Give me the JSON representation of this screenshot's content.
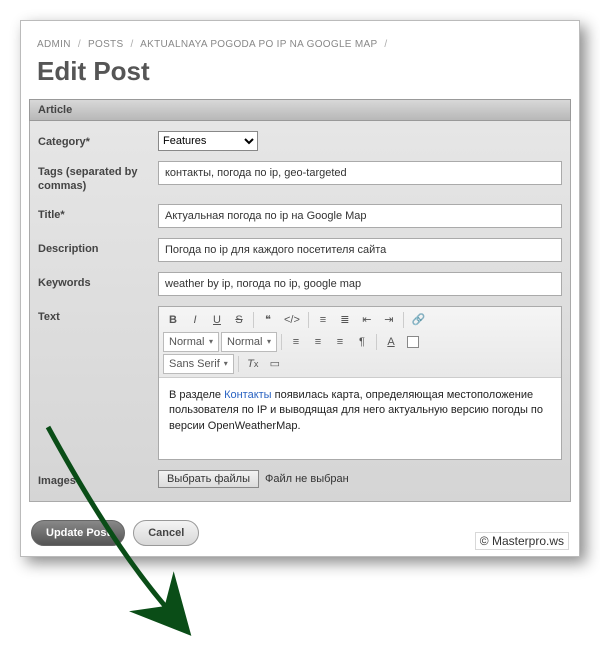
{
  "breadcrumb": [
    "ADMIN",
    "POSTS",
    "AKTUALNAYA POGODA PO IP NA GOOGLE MAP"
  ],
  "page_title": "Edit Post",
  "section_title": "Article",
  "labels": {
    "category": "Category*",
    "tags": "Tags (separated by commas)",
    "title": "Title*",
    "description": "Description",
    "keywords": "Keywords",
    "text": "Text",
    "images": "Images"
  },
  "fields": {
    "category_value": "Features",
    "tags": "контакты, погода по ip, geo-targeted",
    "title": "Актуальная погода по ip на Google Map",
    "description": "Погода по ip для каждого посетителя сайта",
    "keywords": "weather by ip, погода по ip, google map"
  },
  "editor": {
    "style_select": "Normal",
    "size_select": "Normal",
    "font_select": "Sans Serif",
    "content_prefix": "В разделе ",
    "content_link": "Контакты",
    "content_suffix": " появилась карта, определяющая местоположение пользователя по IP и выводящая для него актуальную версию погоды по версии OpenWeatherMap."
  },
  "file": {
    "button": "Выбрать файлы",
    "status": "Файл не выбран"
  },
  "actions": {
    "submit": "Update Post",
    "cancel": "Cancel"
  },
  "copyright": "© Masterpro.ws"
}
